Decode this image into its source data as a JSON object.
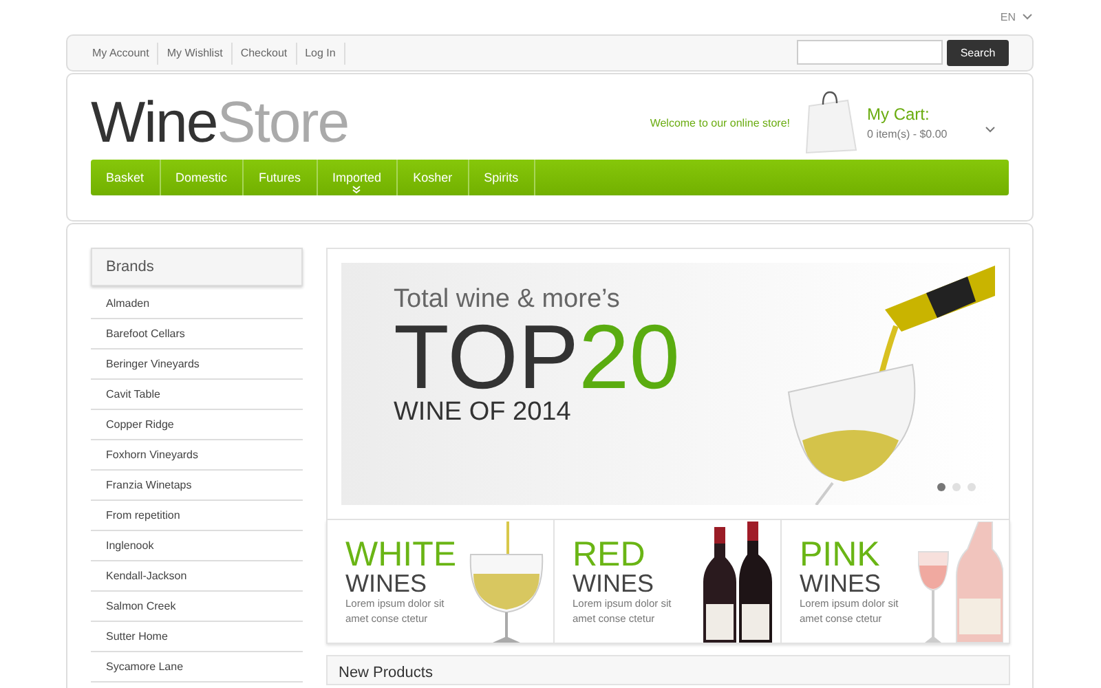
{
  "language": {
    "label": "EN"
  },
  "top_links": [
    "My Account",
    "My Wishlist",
    "Checkout",
    "Log In"
  ],
  "search": {
    "button": "Search"
  },
  "logo": {
    "part_1": "Wine",
    "part_2": "Store"
  },
  "welcome": "Welcome to our online store!",
  "cart": {
    "title": "My Cart:",
    "summary": "0 item(s) - $0.00"
  },
  "nav": [
    {
      "label": "Basket",
      "has_submenu": false
    },
    {
      "label": "Domestic",
      "has_submenu": false
    },
    {
      "label": "Futures",
      "has_submenu": false
    },
    {
      "label": "Imported",
      "has_submenu": true
    },
    {
      "label": "Kosher",
      "has_submenu": false
    },
    {
      "label": "Spirits",
      "has_submenu": false
    }
  ],
  "sidebar": {
    "title": "Brands",
    "items": [
      "Almaden",
      "Barefoot Cellars",
      "Beringer Vineyards",
      "Cavit Table",
      "Copper Ridge",
      "Foxhorn Vineyards",
      "Franzia Winetaps",
      "From repetition",
      "Inglenook",
      "Kendall-Jackson",
      "Salmon Creek",
      "Sutter Home",
      "Sycamore Lane"
    ]
  },
  "slider": {
    "line_1": "Total wine & more’s",
    "big_1": "TOP",
    "big_2": "20",
    "line_2": "WINE OF 2014",
    "dots": [
      {
        "selected": true
      },
      {
        "selected": false
      },
      {
        "selected": false
      }
    ]
  },
  "banners": [
    {
      "kind": "white",
      "title": "WHITE",
      "subtitle": "WINES",
      "text": "Lorem ipsum dolor sit amet conse ctetur"
    },
    {
      "kind": "red",
      "title": "RED",
      "subtitle": "WINES",
      "text": "Lorem ipsum dolor sit amet conse ctetur"
    },
    {
      "kind": "pink",
      "title": "PINK",
      "subtitle": "WINES",
      "text": "Lorem ipsum dolor sit amet conse ctetur"
    }
  ],
  "new_products": {
    "title": "New Products"
  }
}
